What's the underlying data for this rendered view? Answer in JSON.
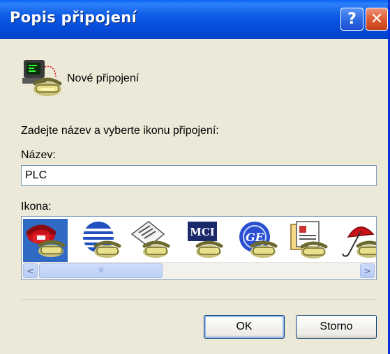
{
  "window": {
    "title": "Popis připojení",
    "help_label": "?",
    "close_label": "✕"
  },
  "connection": {
    "name": "Nové připojení",
    "icon": "phone-computer-icon"
  },
  "form": {
    "instruction": "Zadejte název a vyberte ikonu připojení:",
    "name_label": "Název:",
    "name_value": "PLC",
    "icon_label": "Ikona:"
  },
  "icons": [
    {
      "name": "red-phone-icon",
      "selected": true
    },
    {
      "name": "globe-phone-icon",
      "selected": false
    },
    {
      "name": "newspaper-phone-icon",
      "selected": false
    },
    {
      "name": "mci-phone-icon",
      "selected": false
    },
    {
      "name": "ge-phone-icon",
      "selected": false
    },
    {
      "name": "documents-phone-icon",
      "selected": false
    },
    {
      "name": "umbrella-phone-icon",
      "selected": false
    }
  ],
  "scrollbar": {
    "left_arrow": "<",
    "right_arrow": ">",
    "thumb_grip": "III"
  },
  "buttons": {
    "ok": "OK",
    "cancel": "Storno"
  },
  "colors": {
    "titlebar": "#0548d6",
    "selection": "#316ac5",
    "face": "#ece9d8"
  }
}
